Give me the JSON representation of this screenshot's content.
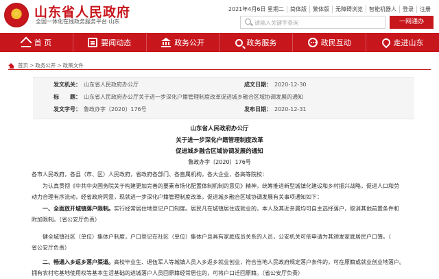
{
  "header": {
    "site_title": "山东省人民政府",
    "site_subtitle": "全国一体化在线政务服务平台·山东",
    "links": [
      "2021年4月6日 星期二",
      "简体版",
      "繁体版",
      "无障碍浏览",
      "智能机器人",
      "登录",
      "注册"
    ],
    "search_placeholder": "请输入关键字查询",
    "search_button": "一网通办"
  },
  "nav": {
    "items": [
      {
        "label": "首 页",
        "icon": "home-icon"
      },
      {
        "label": "要闻动态",
        "icon": "news-icon"
      },
      {
        "label": "政务公开",
        "icon": "government-icon"
      },
      {
        "label": "政务服务",
        "icon": "search-icon"
      },
      {
        "label": "政民互动",
        "icon": "chat-icon"
      },
      {
        "label": "走进山东",
        "icon": "location-pin-icon"
      }
    ]
  },
  "breadcrumb": [
    "首页",
    "政务公开",
    "政策文件"
  ],
  "info": {
    "issuer_label": "发文机关：",
    "issuer": "山东省人民政府办公厅",
    "date_label": "成文日期：",
    "date": "2020-12-30",
    "title_label": "标　　题：",
    "title": "山东省人民政府办公厅关于进一步深化户籍管理制度改革促进城乡融合区域协调发展的通知",
    "docno_label": "发文字号：",
    "docno": "鲁政办字〔2020〕176号",
    "pubdate_label": "发布日期：",
    "pubdate": "2020-12-31"
  },
  "article": {
    "org": "山东省人民政府办公厅",
    "title_1": "关于进一步深化户籍管理制度改革",
    "title_2": "促进城乡融合区域协调发展的通知",
    "docno": "鲁政办字〔2020〕176号",
    "recipients": "各市人民政府，各县（市、区）人民政府，省政府各部门、各直属机构，各大企业，各高等院校：",
    "p1_l1": "为认真贯彻《中共中央国务院关于构建更加完善的要素市场化配置体制机制的意见》精神，统筹推进新型城镇化建设和乡村振兴战略，促进人口和劳",
    "p1_l2": "动力合理有序流动，经省政府同意，现就进一步深化户籍管理制度改革，促进城乡融合区域协调发展有关事项通知如下：",
    "s1_head": "一、全面放开城镇落户限制。",
    "s1_l1": "实行经常居住地登记户口制度。居民凡在城镇居住或就业的，本人及其近亲属均可自主选择落户，取消其他前置条件和",
    "s1_l2": "附加限制。（省公安厅负责）",
    "s1b_l1": "健全城镇社区（单位）集体户制度，户口登记在社区（单位）集体户且具有家庭成员关系的人员，公安机关可依申请为其颁发家庭居民户口簿。（",
    "s1b_l2": "省公安厅负责）",
    "s2_head": "二、畅通入乡返乡落户渠道。",
    "s2_l1": "高校毕业生、退伍军人等城镇人员入乡返乡就业创业，符合当地人民政府规定落户条件的，可在原籍或就业创业地落户。",
    "s2_l2": "拥有农村宅基地使用权等基本生活基础的进城落户人员回原籍经常居住的，可将户口迁回原籍。（省公安厅负责）"
  }
}
